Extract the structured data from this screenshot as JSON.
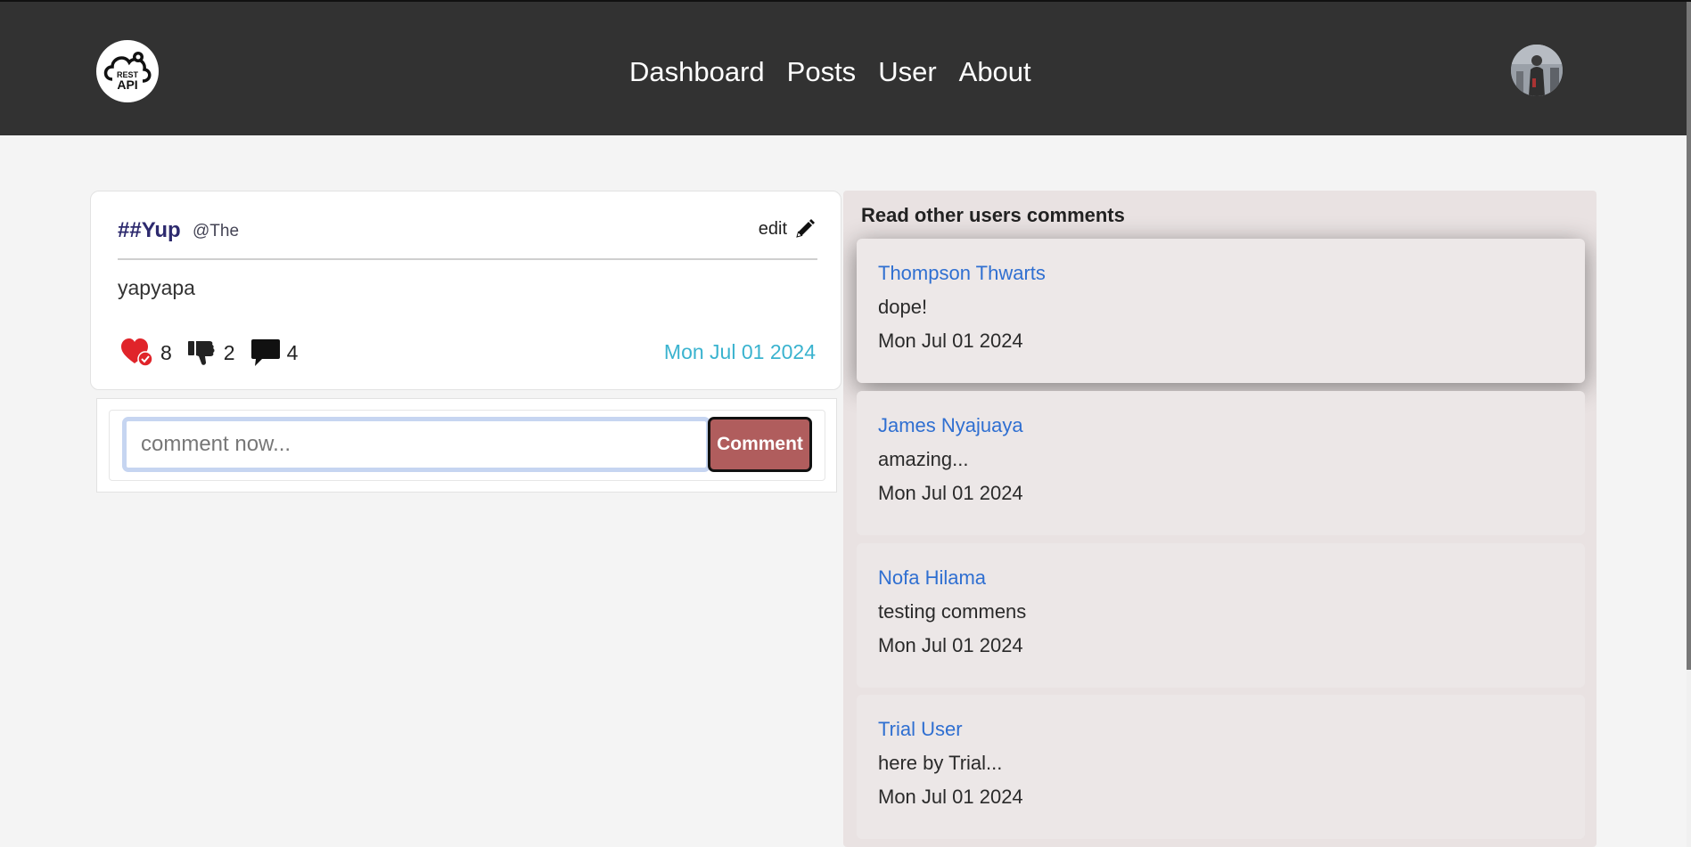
{
  "header": {
    "logo_text_top": "REST",
    "logo_text_bottom": "API",
    "nav": [
      "Dashboard",
      "Posts",
      "User",
      "About"
    ]
  },
  "post": {
    "title": "##Yup",
    "handle": "@The",
    "edit_label": "edit",
    "body": "yapyapa",
    "likes": "8",
    "dislikes": "2",
    "comments": "4",
    "date": "Mon Jul 01 2024"
  },
  "comment_form": {
    "placeholder": "comment now...",
    "button_label": "Comment"
  },
  "comments_panel": {
    "title": "Read other users comments",
    "items": [
      {
        "name": "Thompson Thwarts",
        "text": "dope!",
        "date": "Mon Jul 01 2024"
      },
      {
        "name": "James Nyajuaya",
        "text": "amazing...",
        "date": "Mon Jul 01 2024"
      },
      {
        "name": "Nofa Hilama",
        "text": "testing commens",
        "date": "Mon Jul 01 2024"
      },
      {
        "name": "Trial User",
        "text": "here by Trial...",
        "date": "Mon Jul 01 2024"
      }
    ]
  },
  "colors": {
    "header_bg": "#323232",
    "title": "#2d2a6e",
    "date_accent": "#3ab3cf",
    "comment_button": "#b05d5d",
    "commenter_name": "#2f6fd1"
  }
}
